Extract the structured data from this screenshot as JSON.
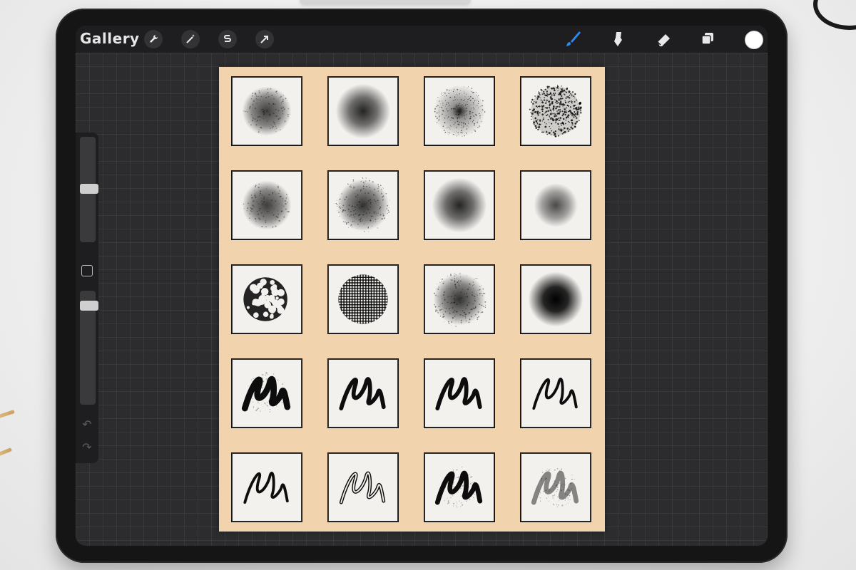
{
  "app": {
    "gallery_label": "Gallery",
    "accent_color": "#2b8cf0",
    "current_color": "#ffffff"
  },
  "toolbar_left": [
    {
      "name": "actions-wrench-icon"
    },
    {
      "name": "adjustments-magic-wand-icon"
    },
    {
      "name": "selection-s-icon"
    },
    {
      "name": "transform-arrow-icon"
    }
  ],
  "toolbar_right": [
    {
      "name": "brush-icon",
      "active": true
    },
    {
      "name": "smudge-icon",
      "active": false
    },
    {
      "name": "eraser-icon",
      "active": false
    },
    {
      "name": "layers-icon",
      "active": false
    }
  ],
  "sidebar": {
    "brush_size_level": 0.45,
    "opacity_level": 0.05,
    "undo_icon": "undo-arrow-icon",
    "redo_icon": "redo-arrow-icon"
  },
  "brush_grid": {
    "rows": 5,
    "columns": 4,
    "swatch_types": [
      [
        "soft-noise",
        "soft-airbrush",
        "stipple",
        "splatter"
      ],
      [
        "soft-noise",
        "grain",
        "soft-airbrush",
        "soft-light"
      ],
      [
        "crackle",
        "crosshatch",
        "grain",
        "hard-airbrush"
      ],
      [
        "scribble-heavy",
        "scribble-ink",
        "scribble-ink",
        "scribble-thin"
      ],
      [
        "scribble-thin",
        "scribble-outline",
        "scribble-charcoal",
        "scribble-sparkle"
      ]
    ]
  }
}
